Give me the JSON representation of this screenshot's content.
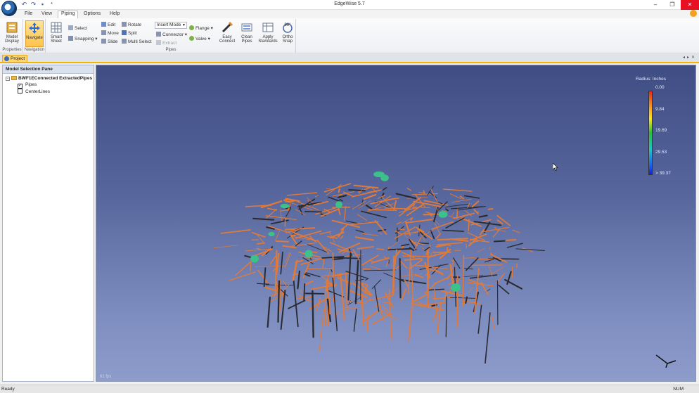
{
  "window": {
    "title": "EdgeWise 5.7",
    "qat_modified_marker": "*"
  },
  "menu": {
    "file": "File",
    "view": "View",
    "piping": "Piping",
    "options": "Options",
    "help": "Help"
  },
  "ribbon": {
    "model_display": "Model Display",
    "navigate": "Navigate",
    "smart_sheet": "Smart Sheet",
    "select": "Select",
    "snapping": "Snapping",
    "edit": "Edit",
    "rotate": "Rotate",
    "move": "Move",
    "split": "Split",
    "slide": "Slide",
    "multi_select": "Multi Select",
    "insert_mode": "Insert Mode",
    "connector": "Connector",
    "extract": "Extract",
    "flange": "Flange",
    "valve": "Valve",
    "easy_connect": "Easy Connect",
    "clean_pipes": "Clean Pipes",
    "apply_standards": "Apply Standards",
    "ortho_snap": "Ortho Snap",
    "ortho_icon_label": "90°",
    "groups": {
      "properties": "Properties",
      "navigation": "Navigation",
      "pipes": "Pipes"
    }
  },
  "tabs": {
    "project": "Project"
  },
  "panel": {
    "title": "Model Selection Pane",
    "root": "BWF1EConnected ExtractedPipes",
    "items": [
      {
        "label": "Pipes",
        "checked": true
      },
      {
        "label": "CenterLines",
        "checked": false
      }
    ]
  },
  "viewport": {
    "fps": "61 fps",
    "legend": {
      "title": "Radius: Inches",
      "labels": [
        "0.00",
        "9.84",
        "19.69",
        "29.53",
        "> 39.37"
      ]
    }
  },
  "status": {
    "left": "Ready",
    "right": "NUM"
  },
  "colors": {
    "accent": "#f4b400",
    "pipe_orange": "#e07a3a",
    "pipe_dark": "#2a2a30",
    "pipe_green": "#3ac28a",
    "close_red": "#e81123"
  }
}
